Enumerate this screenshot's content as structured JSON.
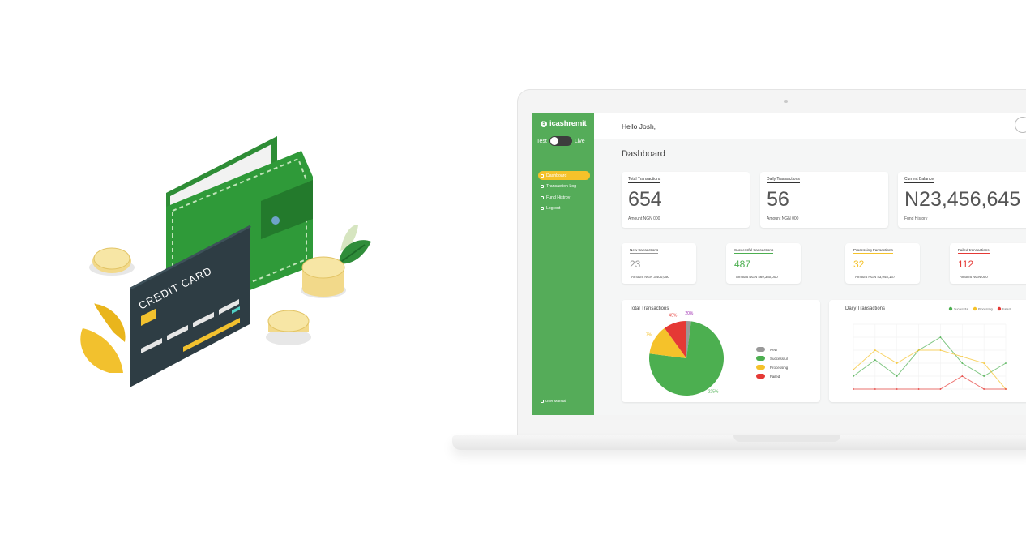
{
  "brand": {
    "name": "icashremit",
    "logo_mark": "$"
  },
  "sidebar": {
    "mode_test": "Test",
    "mode_live": "Live",
    "items": [
      {
        "label": "Dashboard",
        "icon": "dashboard-icon",
        "active": true
      },
      {
        "label": "Transaction Log",
        "icon": "list-icon",
        "active": false
      },
      {
        "label": "Fund Histroy",
        "icon": "history-icon",
        "active": false
      },
      {
        "label": "Log out",
        "icon": "logout-icon",
        "active": false
      }
    ],
    "footer_link": "User Manual"
  },
  "header": {
    "greeting": "Hello Josh,"
  },
  "page": {
    "title": "Dashboard"
  },
  "summary_cards": [
    {
      "label": "Total Transactions",
      "value": "654",
      "sub": "Amount  NGN 000"
    },
    {
      "label": "Daily Transactions",
      "value": "56",
      "sub": "Amount  NGN 000"
    },
    {
      "label": "Current Balance",
      "value": "N23,456,645",
      "sub": "Fund History"
    }
  ],
  "status_cards": [
    {
      "label": "New transactions",
      "value": "23",
      "sub": "Amount  NGN  3,400,050",
      "color": "#999999"
    },
    {
      "label": "Successful transactions",
      "value": "487",
      "sub": "Amount  NGN  469,340,000",
      "color": "#4caf50"
    },
    {
      "label": "Processing transactions",
      "value": "32",
      "sub": "Amount  NGN  43,948,167",
      "color": "#f5c22a"
    },
    {
      "label": "Failed transactions",
      "value": "112",
      "sub": "Amount  NGN  000",
      "color": "#e53935"
    }
  ],
  "chart_data": [
    {
      "type": "pie",
      "title": "Total Transactions",
      "categories": [
        "New",
        "Successful",
        "Processing",
        "Failed"
      ],
      "values": [
        2,
        75,
        13,
        10
      ],
      "data_labels": [
        "20%",
        "225%",
        "7%",
        "45%"
      ],
      "colors": [
        "#999999",
        "#4caf50",
        "#f5c22a",
        "#e53935"
      ]
    },
    {
      "type": "line",
      "title": "Daily Transactions",
      "series": [
        {
          "name": "Successful",
          "color": "#4caf50",
          "values": [
            20,
            45,
            20,
            60,
            80,
            40,
            20,
            40
          ]
        },
        {
          "name": "Processing",
          "color": "#f5c22a",
          "values": [
            30,
            60,
            40,
            60,
            60,
            50,
            40,
            0
          ]
        },
        {
          "name": "Failed",
          "color": "#e53935",
          "values": [
            0,
            0,
            0,
            0,
            0,
            20,
            0,
            0
          ]
        }
      ],
      "ylim": [
        0,
        100
      ],
      "grid": true,
      "legend": "top-right"
    }
  ],
  "illustration": {
    "card_text": "CREDIT CARD"
  }
}
